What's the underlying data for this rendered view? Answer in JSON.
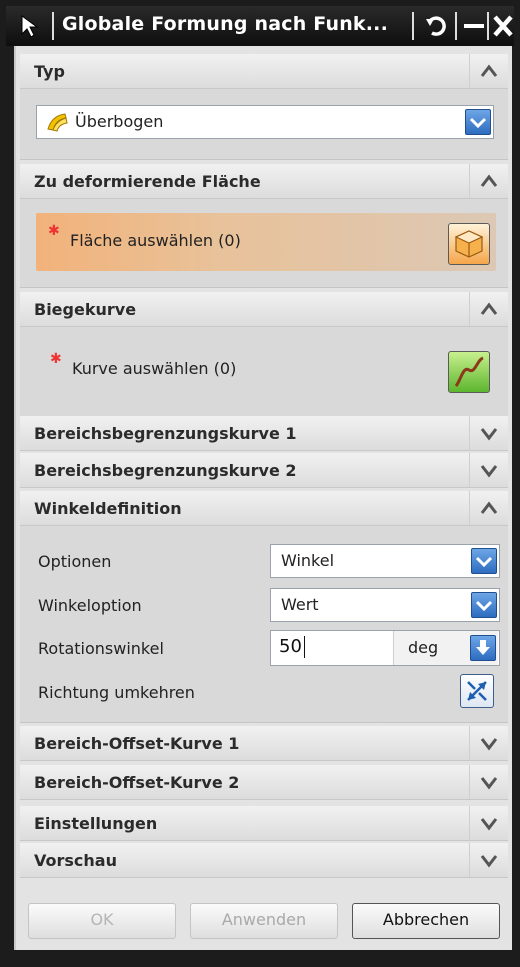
{
  "window": {
    "title": "Globale Formung nach Funk...",
    "icons": [
      "cursor-arrow-icon",
      "reset-icon",
      "minimize-icon",
      "close-icon"
    ]
  },
  "sections": {
    "typ": {
      "label": "Typ",
      "dropdown_value": "Überbogen"
    },
    "face": {
      "label": "Zu deformierende Fläche",
      "select_label": "Fläche auswählen (0)"
    },
    "curve": {
      "label": "Biegekurve",
      "select_label": "Kurve auswählen (0)"
    },
    "range1": {
      "label": "Bereichsbegrenzungskurve 1"
    },
    "range2": {
      "label": "Bereichsbegrenzungskurve 2"
    },
    "angle": {
      "label": "Winkeldefinition",
      "options_label": "Optionen",
      "options_value": "Winkel",
      "angleoption_label": "Winkeloption",
      "angleoption_value": "Wert",
      "rotation_label": "Rotationswinkel",
      "rotation_value": "50",
      "rotation_unit": "deg",
      "reverse_label": "Richtung umkehren"
    },
    "offset1": {
      "label": "Bereich-Offset-Kurve 1"
    },
    "offset2": {
      "label": "Bereich-Offset-Kurve 2"
    },
    "settings": {
      "label": "Einstellungen"
    },
    "preview": {
      "label": "Vorschau"
    }
  },
  "buttons": {
    "ok": "OK",
    "apply": "Anwenden",
    "cancel": "Abbrechen"
  },
  "colors": {
    "accent_blue": "#2d6cc0",
    "selection_orange": "#f2b27a",
    "required_star": "#e33333"
  }
}
